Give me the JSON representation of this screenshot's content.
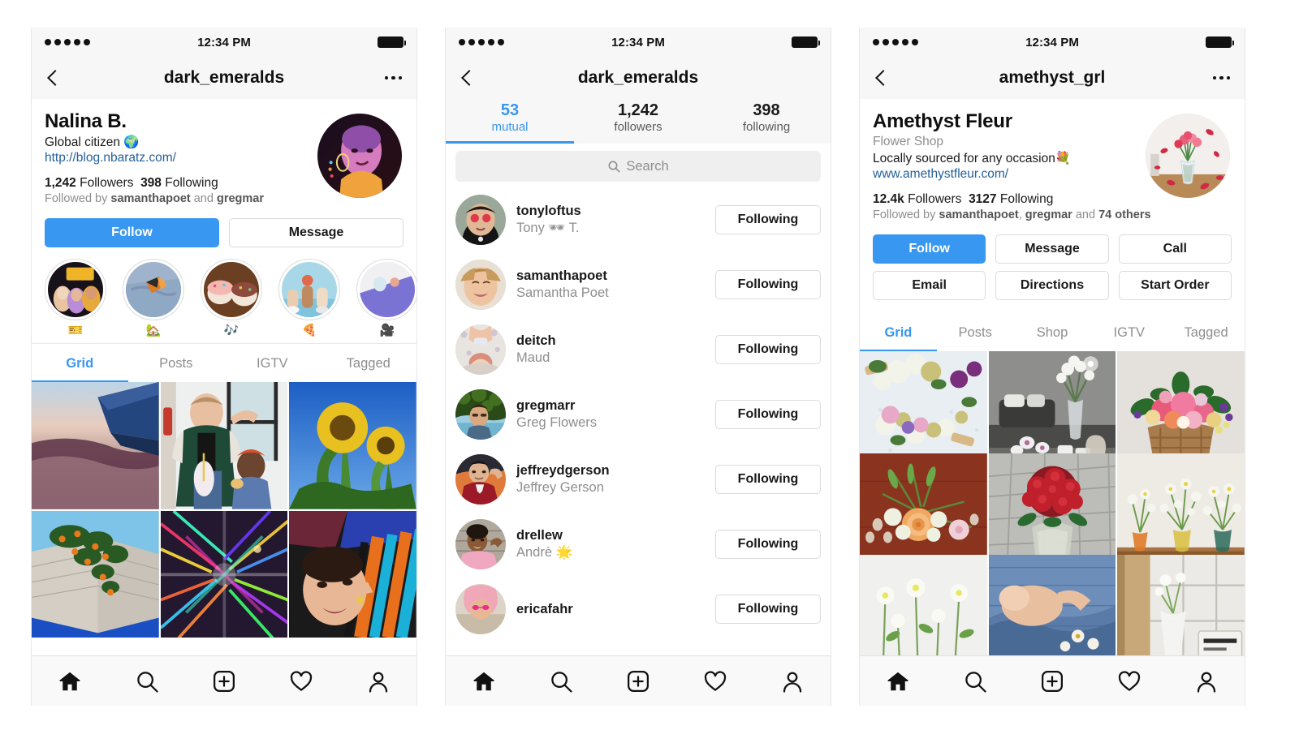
{
  "meta": {
    "accent": "#3897f0",
    "muted": "#8e8e8e",
    "link": "#24609c",
    "panels": 3
  },
  "status_bar": {
    "clock": "12:34 PM",
    "signal_dots": 5,
    "battery_icon": "battery-full-icon"
  },
  "panel1": {
    "nav": {
      "back_icon": "chevron-left-icon",
      "title": "dark_emeralds",
      "more_icon": "more-options-icon"
    },
    "profile": {
      "display_name": "Nalina B.",
      "bio": "Global citizen 🌍",
      "website": "http://blog.nbaratz.com/",
      "followers_count": "1,242",
      "followers_label": "Followers",
      "following_count": "398",
      "following_label": "Following",
      "followed_by_prefix": "Followed by ",
      "followed_by_1": "samanthapoet",
      "followed_by_sep": " and ",
      "followed_by_2": "gregmar",
      "avatar_name": "profile-avatar"
    },
    "actions": [
      {
        "label": "Follow",
        "primary": true,
        "name": "follow-button"
      },
      {
        "label": "Message",
        "primary": false,
        "name": "message-button"
      }
    ],
    "highlights": [
      {
        "label": "🎫",
        "name": "highlight-ticket"
      },
      {
        "label": "🏡",
        "name": "highlight-house"
      },
      {
        "label": "🎶",
        "name": "highlight-music"
      },
      {
        "label": "🍕",
        "name": "highlight-pizza"
      },
      {
        "label": "🎥",
        "name": "highlight-film"
      }
    ],
    "tabs": [
      {
        "label": "Grid",
        "active": true
      },
      {
        "label": "Posts",
        "active": false
      },
      {
        "label": "IGTV",
        "active": false
      },
      {
        "label": "Tagged",
        "active": false
      }
    ],
    "grid": [
      "airplane-wing-sunset",
      "two-friends-milkshake",
      "sunflowers-blue-sky",
      "orange-tree-wall",
      "holographic-rainbow",
      "person-striped-shirt"
    ]
  },
  "panel2": {
    "nav": {
      "back_icon": "chevron-left-icon",
      "title": "dark_emeralds"
    },
    "count_tabs": [
      {
        "number": "53",
        "label": "mutual",
        "active": true
      },
      {
        "number": "1,242",
        "label": "followers",
        "active": false
      },
      {
        "number": "398",
        "label": "following",
        "active": false
      }
    ],
    "search": {
      "placeholder": "Search",
      "icon": "search-icon"
    },
    "users": [
      {
        "username": "tonyloftus",
        "fullname": "Tony 🕶 T.",
        "button": "Following",
        "avatar": "avatar-tonyloftus"
      },
      {
        "username": "samanthapoet",
        "fullname": "Samantha Poet",
        "button": "Following",
        "avatar": "avatar-samanthapoet"
      },
      {
        "username": "deitch",
        "fullname": "Maud",
        "button": "Following",
        "avatar": "avatar-deitch"
      },
      {
        "username": "gregmarr",
        "fullname": "Greg Flowers",
        "button": "Following",
        "avatar": "avatar-gregmarr"
      },
      {
        "username": "jeffreydgerson",
        "fullname": "Jeffrey Gerson",
        "button": "Following",
        "avatar": "avatar-jeffreydgerson"
      },
      {
        "username": "drellew",
        "fullname": "Andrè 🌟",
        "button": "Following",
        "avatar": "avatar-drellew"
      },
      {
        "username": "ericafahr",
        "fullname": "",
        "button": "Following",
        "avatar": "avatar-ericafahr"
      }
    ]
  },
  "panel3": {
    "nav": {
      "back_icon": "chevron-left-icon",
      "title": "amethyst_grl",
      "more_icon": "more-options-icon"
    },
    "profile": {
      "display_name": "Amethyst Fleur",
      "category": "Flower Shop",
      "bio": "Locally sourced for any occasion💐",
      "website": "www.amethystfleur.com/",
      "followers_count": "12.4k",
      "followers_label": "Followers",
      "following_count": "3127",
      "following_label": "Following",
      "followed_by_prefix": "Followed by ",
      "followed_by_1": "samanthapoet",
      "followed_by_sep": ", ",
      "followed_by_2": "gregmar",
      "followed_by_suffix": " and ",
      "followed_by_3": "74 others",
      "avatar_name": "profile-avatar"
    },
    "actions_row1": [
      {
        "label": "Follow",
        "primary": true,
        "name": "follow-button"
      },
      {
        "label": "Message",
        "primary": false,
        "name": "message-button"
      },
      {
        "label": "Call",
        "primary": false,
        "name": "call-button"
      }
    ],
    "actions_row2": [
      {
        "label": "Email",
        "primary": false,
        "name": "email-button"
      },
      {
        "label": "Directions",
        "primary": false,
        "name": "directions-button"
      },
      {
        "label": "Start Order",
        "primary": false,
        "name": "start-order-button"
      }
    ],
    "tabs": [
      {
        "label": "Grid",
        "active": true
      },
      {
        "label": "Posts",
        "active": false
      },
      {
        "label": "Shop",
        "active": false
      },
      {
        "label": "IGTV",
        "active": false
      },
      {
        "label": "Tagged",
        "active": false
      }
    ],
    "grid": [
      "white-purple-corsages",
      "white-flowers-livingroom",
      "pink-basket-bouquet",
      "peach-rose-arrangement",
      "red-roses-bouquet",
      "white-flowers-shelf",
      "white-blooms-row",
      "denim-flowers",
      "vase-window-sign"
    ]
  },
  "tabbar": [
    {
      "name": "home-icon",
      "label": "Home",
      "active": true
    },
    {
      "name": "search-icon",
      "label": "Search",
      "active": false
    },
    {
      "name": "add-post-icon",
      "label": "New Post",
      "active": false
    },
    {
      "name": "heart-icon",
      "label": "Activity",
      "active": false
    },
    {
      "name": "profile-icon",
      "label": "Profile",
      "active": false
    }
  ]
}
